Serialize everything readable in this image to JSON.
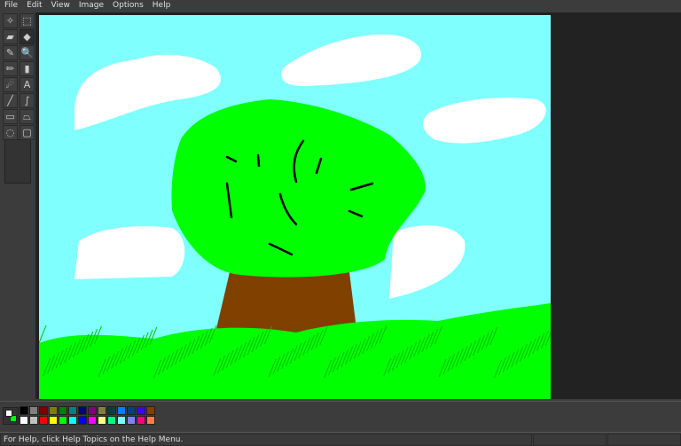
{
  "menu": [
    "File",
    "Edit",
    "View",
    "Image",
    "Options",
    "Help"
  ],
  "tools": [
    {
      "name": "free-form-select-icon",
      "glyph": "✧"
    },
    {
      "name": "rectangle-select-icon",
      "glyph": "⬚"
    },
    {
      "name": "eraser-icon",
      "glyph": "▰"
    },
    {
      "name": "fill-bucket-icon",
      "glyph": "◆"
    },
    {
      "name": "color-picker-icon",
      "glyph": "✎"
    },
    {
      "name": "magnifier-icon",
      "glyph": "🔍"
    },
    {
      "name": "pencil-icon",
      "glyph": "✏"
    },
    {
      "name": "brush-icon",
      "glyph": "▮"
    },
    {
      "name": "airbrush-icon",
      "glyph": "☄"
    },
    {
      "name": "text-icon",
      "glyph": "A"
    },
    {
      "name": "line-icon",
      "glyph": "╱"
    },
    {
      "name": "curve-icon",
      "glyph": "∫"
    },
    {
      "name": "rectangle-icon",
      "glyph": "▭"
    },
    {
      "name": "polygon-icon",
      "glyph": "⏢"
    },
    {
      "name": "ellipse-icon",
      "glyph": "◌"
    },
    {
      "name": "rounded-rectangle-icon",
      "glyph": "▢"
    }
  ],
  "colors": {
    "sky": "#80ffff",
    "cloud": "#ffffff",
    "leaves": "#00ff00",
    "trunk": "#804000",
    "grass": "#00ff00",
    "primary": "#ffffff",
    "secondary": "#00ff00"
  },
  "palette_top": [
    "#000000",
    "#808080",
    "#800000",
    "#808000",
    "#008000",
    "#008080",
    "#000080",
    "#800080",
    "#808040",
    "#004040",
    "#0080ff",
    "#004080",
    "#4000ff",
    "#804000"
  ],
  "palette_bottom": [
    "#ffffff",
    "#c0c0c0",
    "#ff0000",
    "#ffff00",
    "#00ff00",
    "#00ffff",
    "#0000ff",
    "#ff00ff",
    "#ffff80",
    "#00ff80",
    "#80ffff",
    "#8080ff",
    "#ff0080",
    "#ff8040"
  ],
  "status": {
    "help": "For Help, click Help Topics on the Help Menu."
  }
}
